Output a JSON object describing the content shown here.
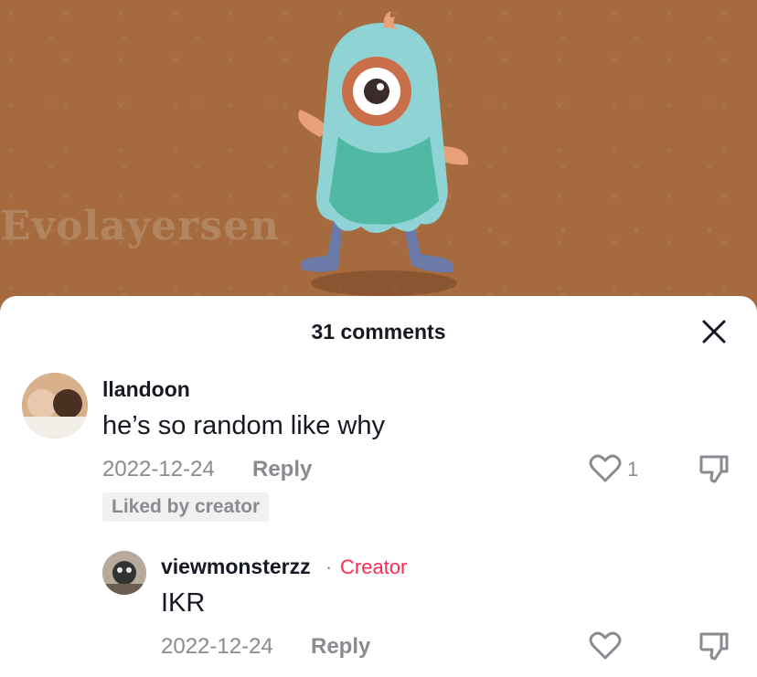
{
  "video": {
    "watermark": "Evolayersen"
  },
  "sheet": {
    "title": "31 comments"
  },
  "comments": [
    {
      "username": "llandoon",
      "text": "he’s so random like why",
      "date": "2022-12-24",
      "reply_label": "Reply",
      "like_count": "1",
      "badge": "Liked by creator"
    },
    {
      "username": "viewmonsterzz",
      "separator": "·",
      "tag": "Creator",
      "text": "IKR",
      "date": "2022-12-24",
      "reply_label": "Reply"
    }
  ],
  "colors": {
    "accent": "#fe2c55",
    "muted": "#8a8b91",
    "text": "#161823",
    "video_bg": "#a56a3e"
  },
  "icons": {
    "close": "close-icon",
    "like": "heart-icon",
    "dislike": "thumbs-down-icon"
  }
}
